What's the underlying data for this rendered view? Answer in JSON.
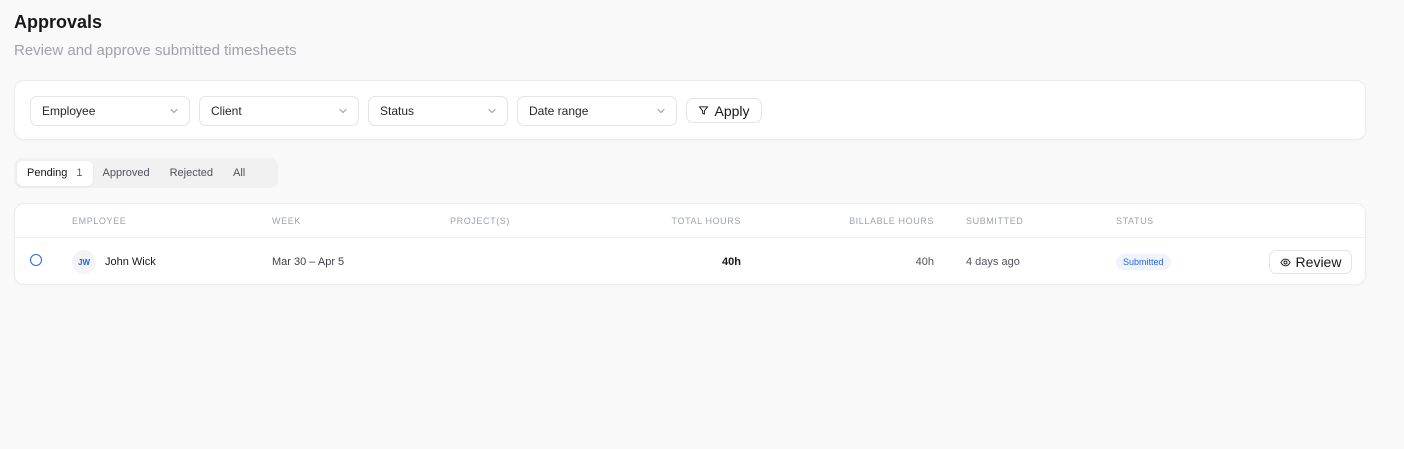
{
  "header": {
    "title": "Approvals",
    "subtitle": "Review and approve submitted timesheets"
  },
  "filters": {
    "employee": "Employee",
    "client": "Client",
    "status": "Status",
    "date_range": "Date range",
    "apply_label": "Apply"
  },
  "tabs": [
    {
      "label": "Pending",
      "count": "1",
      "active": true
    },
    {
      "label": "Approved"
    },
    {
      "label": "Rejected"
    },
    {
      "label": "All"
    }
  ],
  "table": {
    "columns": {
      "employee": "Employee",
      "week": "Week",
      "projects": "Project(s)",
      "total_hours": "Total hours",
      "billable_hours": "Billable hours",
      "submitted": "Submitted",
      "status": "Status"
    },
    "rows": [
      {
        "initials": "JW",
        "name": "John Wick",
        "week": "Mar 30 – Apr 5",
        "projects": "",
        "total_hours": "40h",
        "billable_hours": "40h",
        "submitted": "4 days ago",
        "status": "Submitted",
        "action_label": "Review"
      }
    ]
  },
  "colors": {
    "accent": "#2563eb",
    "background": "#f9f9f9",
    "badge_bg": "#eff3fb"
  },
  "icons": {
    "select_chevron": "chevron-down-icon",
    "apply": "filter-icon",
    "review": "eye-icon"
  }
}
